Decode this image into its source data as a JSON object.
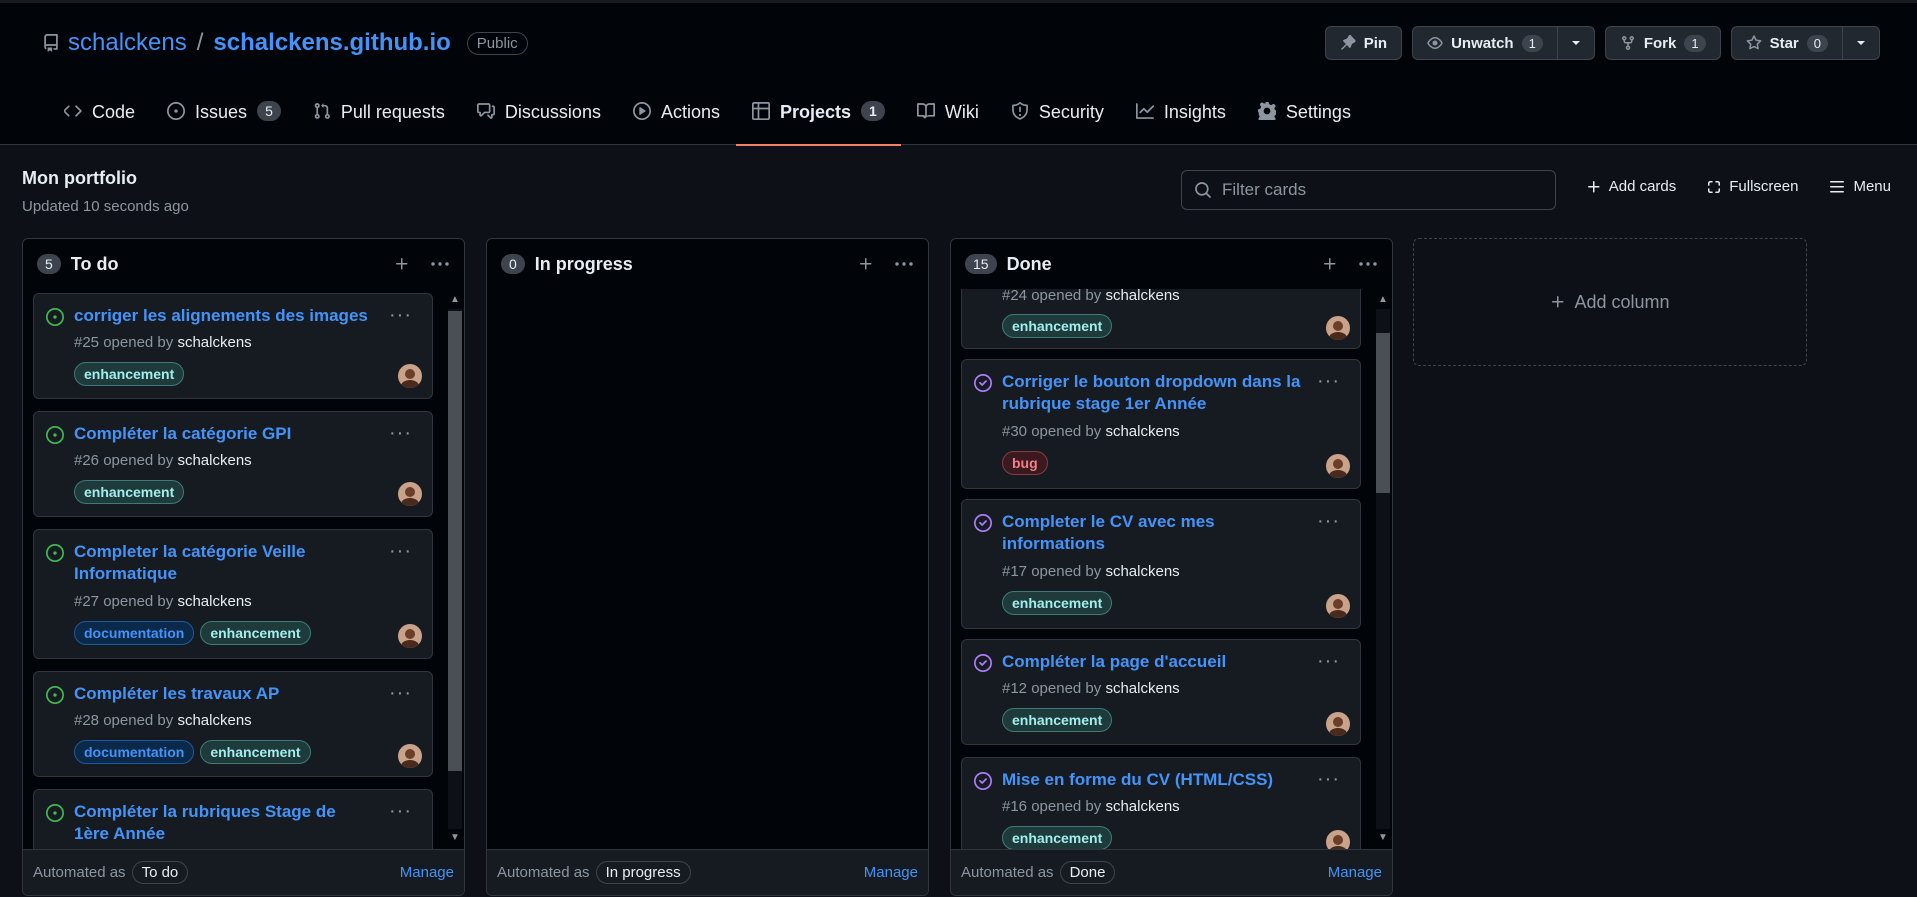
{
  "repo": {
    "owner": "schalckens",
    "separator": "/",
    "name": "schalckens.github.io",
    "visibility": "Public"
  },
  "header_actions": {
    "pin": "Pin",
    "unwatch": "Unwatch",
    "unwatch_count": "1",
    "fork": "Fork",
    "fork_count": "1",
    "star": "Star",
    "star_count": "0"
  },
  "tabs": [
    {
      "label": "Code"
    },
    {
      "label": "Issues",
      "count": "5"
    },
    {
      "label": "Pull requests"
    },
    {
      "label": "Discussions"
    },
    {
      "label": "Actions"
    },
    {
      "label": "Projects",
      "count": "1"
    },
    {
      "label": "Wiki"
    },
    {
      "label": "Security"
    },
    {
      "label": "Insights"
    },
    {
      "label": "Settings"
    }
  ],
  "project": {
    "title": "Mon portfolio",
    "updated": "Updated 10 seconds ago",
    "filter_placeholder": "Filter cards",
    "add_cards": "Add cards",
    "fullscreen": "Fullscreen",
    "menu": "Menu",
    "add_column": "Add column"
  },
  "columns": [
    {
      "count": "5",
      "name": "To do",
      "automated_label": "Automated as",
      "automated_value": "To do",
      "manage": "Manage",
      "cards": [
        {
          "title": "corriger les alignements des images",
          "number": "#25",
          "opened_by": "opened by",
          "author": "schalckens",
          "labels": [
            "enhancement"
          ]
        },
        {
          "title": "Compléter la catégorie GPI",
          "number": "#26",
          "opened_by": "opened by",
          "author": "schalckens",
          "labels": [
            "enhancement"
          ]
        },
        {
          "title": "Completer la catégorie Veille Informatique",
          "number": "#27",
          "opened_by": "opened by",
          "author": "schalckens",
          "labels": [
            "documentation",
            "enhancement"
          ]
        },
        {
          "title": "Compléter les travaux AP",
          "number": "#28",
          "opened_by": "opened by",
          "author": "schalckens",
          "labels": [
            "documentation",
            "enhancement"
          ]
        },
        {
          "title": "Compléter la rubriques Stage de 1ère Année",
          "number": "",
          "opened_by": "",
          "author": "",
          "labels": []
        }
      ]
    },
    {
      "count": "0",
      "name": "In progress",
      "automated_label": "Automated as",
      "automated_value": "In progress",
      "manage": "Manage",
      "cards": []
    },
    {
      "count": "15",
      "name": "Done",
      "automated_label": "Automated as",
      "automated_value": "Done",
      "manage": "Manage",
      "cards": [
        {
          "title": "",
          "number": "#24",
          "opened_by": "opened by",
          "author": "schalckens",
          "labels": [
            "enhancement"
          ]
        },
        {
          "title": "Corriger le bouton dropdown dans la rubrique stage 1er Année",
          "number": "#30",
          "opened_by": "opened by",
          "author": "schalckens",
          "labels": [
            "bug"
          ]
        },
        {
          "title": "Completer le CV avec mes informations",
          "number": "#17",
          "opened_by": "opened by",
          "author": "schalckens",
          "labels": [
            "enhancement"
          ]
        },
        {
          "title": "Compléter la page d'accueil",
          "number": "#12",
          "opened_by": "opened by",
          "author": "schalckens",
          "labels": [
            "enhancement"
          ]
        },
        {
          "title": "Mise en forme du CV (HTML/CSS)",
          "number": "#16",
          "opened_by": "opened by",
          "author": "schalckens",
          "labels": [
            "enhancement"
          ]
        }
      ]
    }
  ],
  "colors": {
    "accent": "#4493f8",
    "tab_underline": "#f78166",
    "open_issue": "#3fb950",
    "closed_issue": "#ab7df8"
  }
}
